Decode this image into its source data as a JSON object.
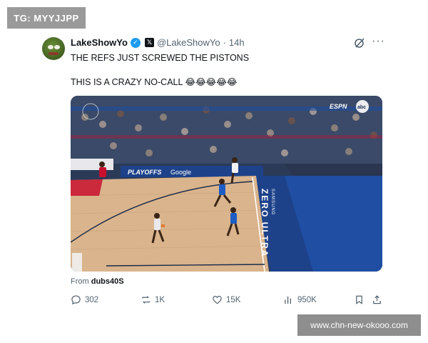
{
  "watermarks": {
    "top_left": "TG: MYYJJPP",
    "bottom_right": "www.chn-new-okooo.com"
  },
  "tweet": {
    "display_name": "LakeShowYo",
    "handle": "@LakeShowYo",
    "separator": "·",
    "time": "14h",
    "verified_icon": "verified-badge-icon",
    "text_line1": "THE REFS JUST SCREWED THE PISTONS",
    "text_line2": "THIS IS A CRAZY NO-CALL 😂😂😂😂😂",
    "from_label": "From",
    "from_source": "dubs40S",
    "colors": {
      "accent": "#1d9bf0",
      "text": "#0f1419",
      "muted": "#536471"
    }
  },
  "media": {
    "scorebug_network": "ESPN",
    "scorebug_network2": "abc",
    "ad_board_left": "PLAYOFFS",
    "ad_board_google": "Google",
    "court_logo_text": "ZERO ULTRA",
    "court_logo_sub": "SAMSUNG"
  },
  "actions": {
    "replies": "302",
    "reposts": "1K",
    "likes": "15K",
    "views": "950K"
  }
}
